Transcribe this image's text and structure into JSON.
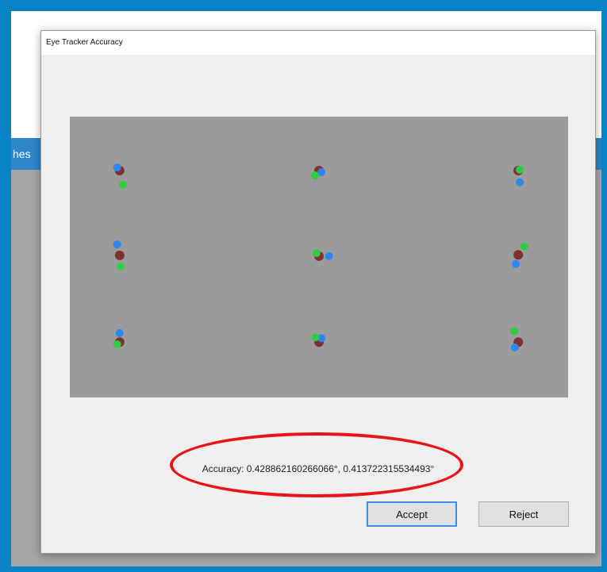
{
  "background": {
    "strip_text": "hes",
    "colors": {
      "frame": "#0a84c6",
      "strip": "#2f86c8",
      "gray": "#a6a6a6"
    }
  },
  "dialog": {
    "title": "Eye Tracker Accuracy",
    "accuracy_text": "Accuracy: 0.428862160266066°, 0.413722315534493°",
    "buttons": {
      "accept": "Accept",
      "reject": "Reject"
    }
  },
  "chart_data": {
    "type": "scatter",
    "title": "",
    "xlabel": "",
    "ylabel": "",
    "xlim": [
      0,
      1
    ],
    "ylim": [
      0,
      1
    ],
    "series": [
      {
        "color": "#7a1f1f",
        "opacity": 0.85,
        "points": [
          [
            0.1,
            0.808
          ],
          [
            0.5,
            0.808
          ],
          [
            0.9,
            0.808
          ],
          [
            0.1,
            0.506
          ],
          [
            0.5,
            0.503
          ],
          [
            0.9,
            0.508
          ],
          [
            0.1,
            0.197
          ],
          [
            0.5,
            0.197
          ],
          [
            0.9,
            0.197
          ]
        ]
      },
      {
        "color": "#2e86f0",
        "points": [
          [
            0.095,
            0.819
          ],
          [
            0.505,
            0.802
          ],
          [
            0.903,
            0.766
          ],
          [
            0.095,
            0.545
          ],
          [
            0.52,
            0.503
          ],
          [
            0.895,
            0.475
          ],
          [
            0.1,
            0.229
          ],
          [
            0.505,
            0.211
          ],
          [
            0.893,
            0.178
          ]
        ]
      },
      {
        "color": "#2ecc40",
        "points": [
          [
            0.107,
            0.757
          ],
          [
            0.492,
            0.791
          ],
          [
            0.903,
            0.811
          ],
          [
            0.102,
            0.466
          ],
          [
            0.495,
            0.514
          ],
          [
            0.912,
            0.537
          ],
          [
            0.095,
            0.189
          ],
          [
            0.493,
            0.214
          ],
          [
            0.892,
            0.236
          ]
        ]
      }
    ],
    "annotation": {
      "shape": "ellipse",
      "color": "#e8141a",
      "target": "accuracy_text"
    }
  }
}
